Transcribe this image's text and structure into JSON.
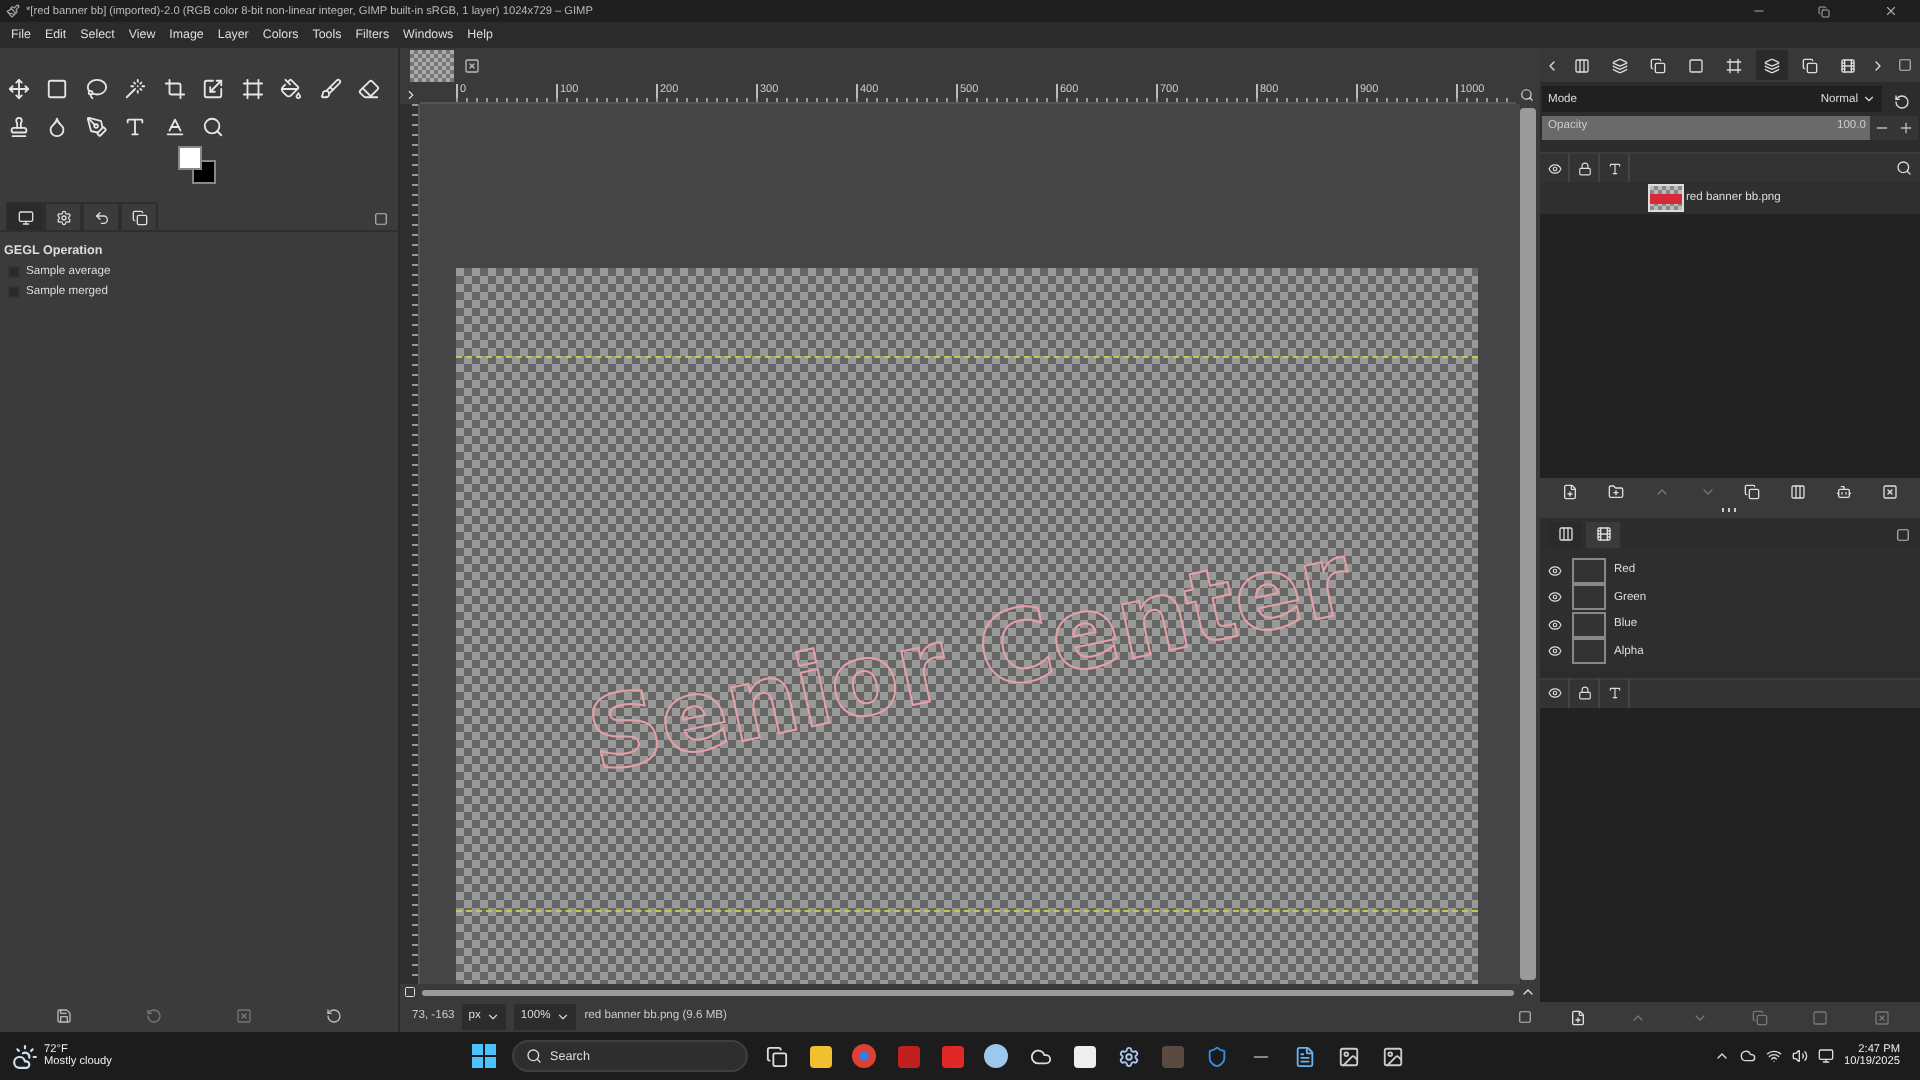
{
  "title_bar": {
    "title": "*[red banner bb] (imported)-2.0 (RGB color 8-bit non-linear integer, GIMP built-in sRGB, 1 layer) 1024x729 – GIMP"
  },
  "menu": [
    "File",
    "Edit",
    "Select",
    "View",
    "Image",
    "Layer",
    "Colors",
    "Tools",
    "Filters",
    "Windows",
    "Help"
  ],
  "tool_options": {
    "title": "GEGL Operation",
    "options": [
      {
        "label": "Sample average",
        "checked": false
      },
      {
        "label": "Sample merged",
        "checked": false
      }
    ]
  },
  "ruler": {
    "labels": [
      "0",
      "100",
      "200",
      "300",
      "400",
      "500",
      "600",
      "700",
      "800",
      "900",
      "1000"
    ]
  },
  "canvas_text": "Senior Center",
  "layers_panel": {
    "mode_label": "Mode",
    "mode_value": "Normal",
    "opacity_label": "Opacity",
    "opacity_value": "100.0",
    "level": 1,
    "layers": [
      {
        "name": "red banner bb.png",
        "selected": true
      }
    ]
  },
  "channels": [
    {
      "name": "Red",
      "visible": true
    },
    {
      "name": "Green",
      "visible": true
    },
    {
      "name": "Blue",
      "visible": true
    },
    {
      "name": "Alpha",
      "visible": true
    }
  ],
  "status_bar": {
    "coords": "73, -163",
    "unit": "px",
    "zoom": "100%",
    "message": "red banner bb.png (9.6 MB)"
  },
  "taskbar": {
    "temperature": "72°F",
    "weather": "Mostly cloudy",
    "search_placeholder": "Search",
    "time": "2:47 PM",
    "date": "10/19/2025"
  }
}
